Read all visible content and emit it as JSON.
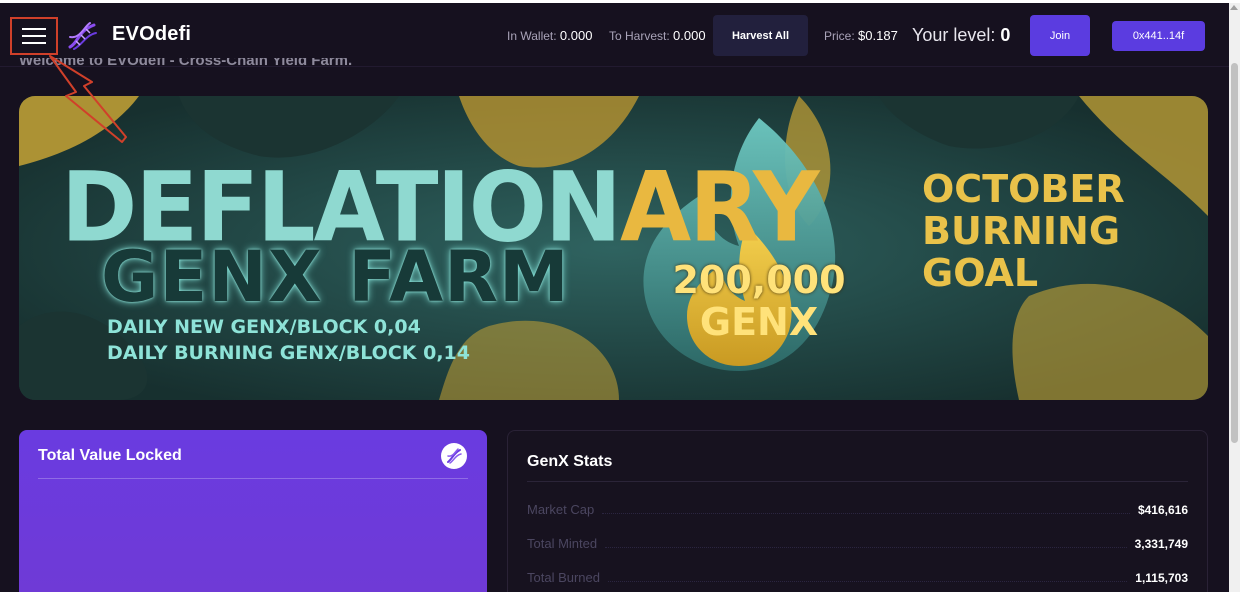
{
  "header": {
    "brand": "EVOdefi",
    "in_wallet_label": "In Wallet:",
    "in_wallet_value": "0.000",
    "to_harvest_label": "To Harvest:",
    "to_harvest_value": "0.000",
    "harvest_button": "Harvest All",
    "price_label": "Price:",
    "price_value": "$0.187",
    "level_label": "Your level:",
    "level_value": "0",
    "join_button": "Join",
    "wallet_button": "0x441..14f"
  },
  "welcome": "Welcome to EVOdefi - Cross-Chain Yield Farm.",
  "banner": {
    "title_main": "DEFLATION",
    "title_accent": "ARY",
    "title_sub": "GENX FARM",
    "line1": "DAILY NEW GENX/BLOCK  0,04",
    "line2": "DAILY BURNING GENX/BLOCK  0,14",
    "goal_amount": "200,000",
    "goal_token": "GENX",
    "goal_line1": "OCTOBER",
    "goal_line2": "BURNING",
    "goal_line3": "GOAL"
  },
  "tvl": {
    "title": "Total Value Locked"
  },
  "stats": {
    "title": "GenX Stats",
    "rows": [
      {
        "label": "Market Cap",
        "value": "$416,616"
      },
      {
        "label": "Total Minted",
        "value": "3,331,749"
      },
      {
        "label": "Total Burned",
        "value": "1,115,703"
      }
    ]
  },
  "colors": {
    "background": "#16111f",
    "accent": "#5b3ce0",
    "card_purple": "#6a3be0",
    "annotation": "#d0402a"
  },
  "icons": [
    "menu-icon",
    "dna-logo-icon",
    "dna-badge-icon"
  ]
}
